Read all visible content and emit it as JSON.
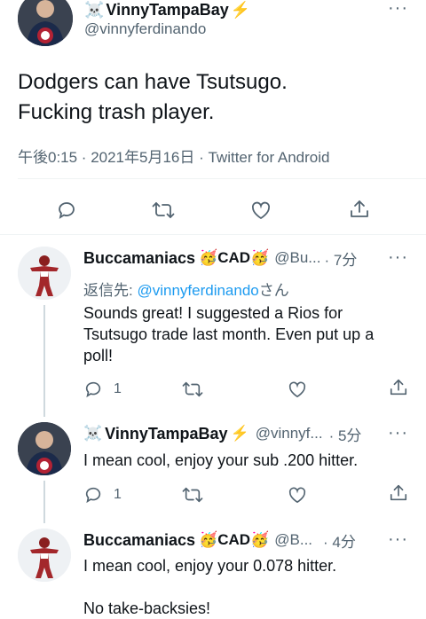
{
  "main_tweet": {
    "skull": "☠️",
    "name": "VinnyTampaBay",
    "bolt": "⚡",
    "handle": "@vinnyferdinando",
    "text_line1": "Dodgers can have Tsutsugo.",
    "text_line2": "Fucking trash player.",
    "meta": "午後0:15 · 2021年5月16日 · Twitter for Android",
    "more": "···"
  },
  "replies": [
    {
      "name": "Buccamaniacs",
      "badges": "🥳CAD🥳",
      "handle": "@Bu...",
      "time": "· 7分",
      "reply_to_prefix": "返信先: ",
      "reply_to_handle": "@vinnyferdinando",
      "reply_to_suffix": "さん",
      "line1": "Sounds great! I suggested a Rios for",
      "line2": "Tsutsugo trade last month. Even put up a",
      "line3": "poll!",
      "reply_count": "1",
      "more": "···"
    },
    {
      "skull": "☠️",
      "name": "VinnyTampaBay",
      "bolt": "⚡",
      "handle": "@vinnyf...",
      "time": "· 5分",
      "line1": "I mean cool, enjoy your sub .200 hitter.",
      "reply_count": "1",
      "more": "···"
    },
    {
      "name": "Buccamaniacs",
      "badges": "🥳CAD🥳",
      "handle": "@B...",
      "time": "· 4分",
      "line1": "I mean cool, enjoy your 0.078 hitter.",
      "line2": "No take-backsies!",
      "more": "···"
    }
  ],
  "colors": {
    "accent": "#1d9bf0",
    "muted": "#536471",
    "bolt": "#f4b400"
  },
  "icons": [
    "reply-icon",
    "retweet-icon",
    "like-icon",
    "share-icon",
    "more-icon"
  ]
}
